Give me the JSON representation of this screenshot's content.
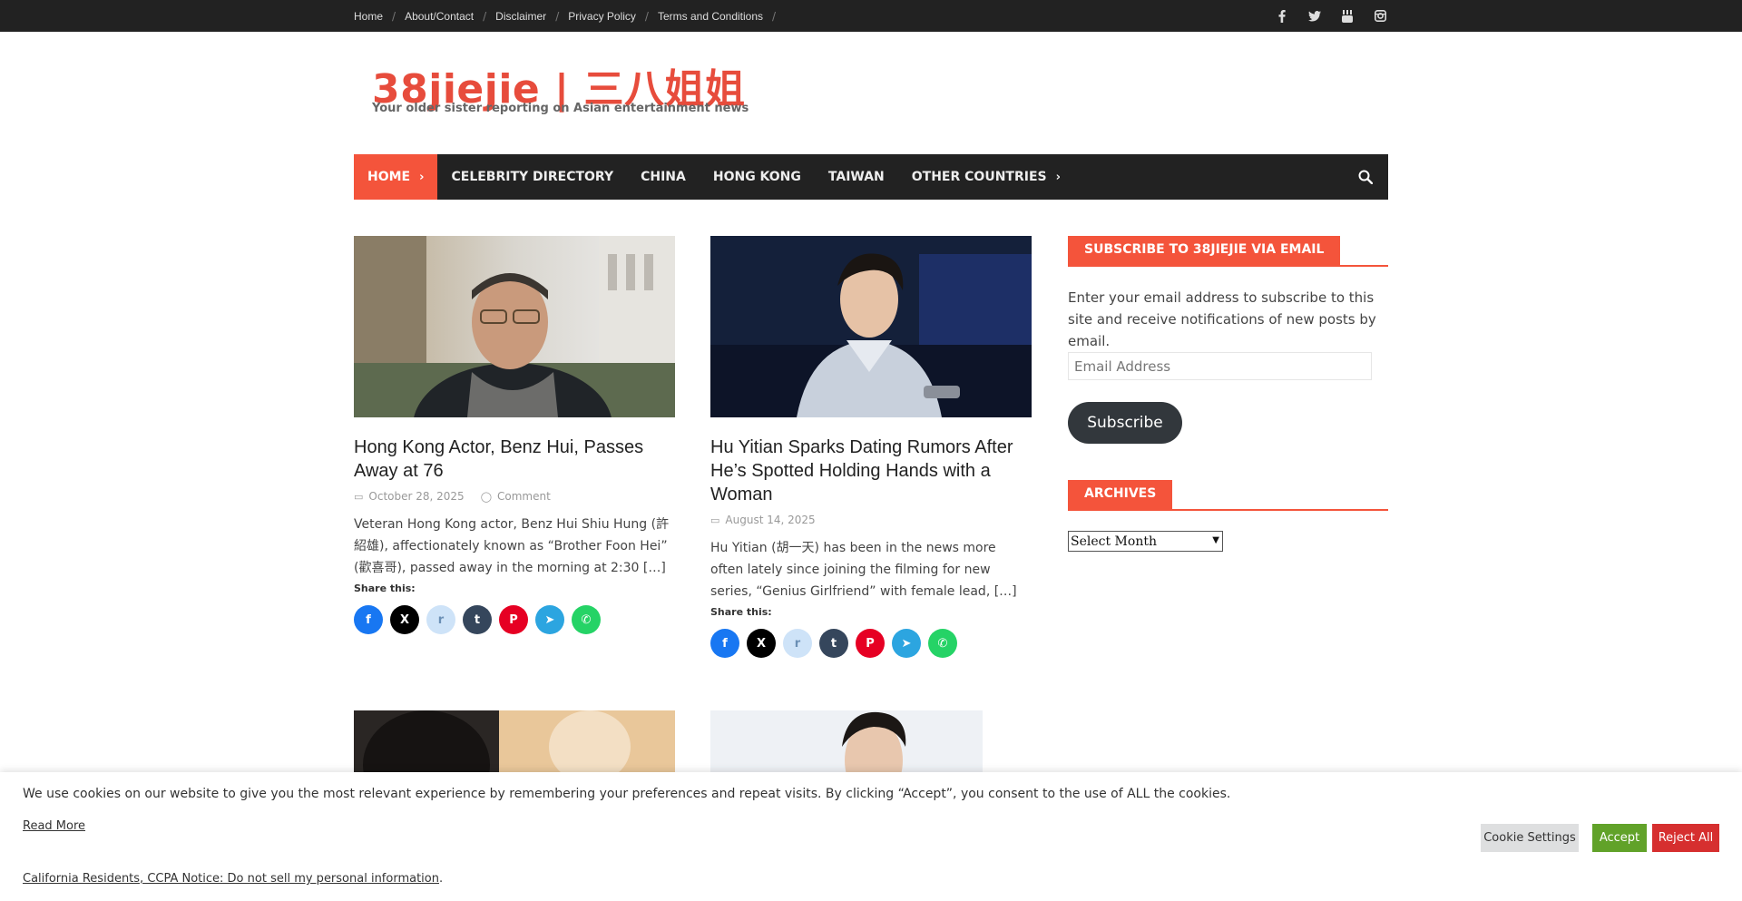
{
  "topbar": {
    "links": [
      "Home",
      "About/Contact",
      "Disclaimer",
      "Privacy Policy",
      "Terms and Conditions"
    ],
    "social": [
      "facebook-icon",
      "twitter-icon",
      "youtube-icon",
      "instagram-icon"
    ]
  },
  "header": {
    "title": "38jiejie | 三八姐姐",
    "tagline": "Your older sister reporting on Asian entertainment news"
  },
  "nav": {
    "items": [
      {
        "label": "Home",
        "active": true,
        "chevron": true
      },
      {
        "label": "Celebrity Directory",
        "active": false,
        "chevron": false
      },
      {
        "label": "China",
        "active": false,
        "chevron": false
      },
      {
        "label": "Hong Kong",
        "active": false,
        "chevron": false
      },
      {
        "label": "Taiwan",
        "active": false,
        "chevron": false
      },
      {
        "label": "Other Countries",
        "active": false,
        "chevron": true
      }
    ]
  },
  "posts": [
    {
      "title": "Hong Kong Actor, Benz Hui, Passes Away at 76",
      "date": "October 28, 2025",
      "comment": "Comment",
      "excerpt": "Veteran Hong Kong actor, Benz Hui Shiu Hung (許紹雄), affectionately known as “Brother Foon Hei” (歡喜哥), passed away in the morning at 2:30 […]",
      "share_label": "Share this:"
    },
    {
      "title": "Hu Yitian Sparks Dating Rumors After He’s Spotted Holding Hands with a Woman",
      "date": "August 14, 2025",
      "comment": "",
      "excerpt": "Hu Yitian (胡一天) has been in the news more often lately since joining the filming for new series, “Genius Girlfriend” with female lead, […]",
      "share_label": "Share this:"
    }
  ],
  "share_buttons": [
    {
      "name": "facebook",
      "color": "#1877f2",
      "glyph": "f"
    },
    {
      "name": "x",
      "color": "#000000",
      "glyph": "X"
    },
    {
      "name": "reddit",
      "color": "#cee3f8",
      "glyph": "r"
    },
    {
      "name": "tumblr",
      "color": "#35465c",
      "glyph": "t"
    },
    {
      "name": "pinterest",
      "color": "#e60023",
      "glyph": "P"
    },
    {
      "name": "telegram",
      "color": "#2ca5e0",
      "glyph": "➤"
    },
    {
      "name": "whatsapp",
      "color": "#25d366",
      "glyph": "✆"
    }
  ],
  "sidebar": {
    "subscribe_title": "SUBSCRIBE TO 38JIEJIE VIA EMAIL",
    "subscribe_text": "Enter your email address to subscribe to this site and receive notifications of new posts by email.",
    "email_placeholder": "Email Address",
    "subscribe_button": "Subscribe",
    "archives_title": "ARCHIVES",
    "archives_select": "Select Month"
  },
  "cookie": {
    "message": "We use cookies on our website to give you the most relevant experience by remembering your preferences and repeat visits. By clicking “Accept”, you consent to the use of ALL the cookies.",
    "read_more": "Read More",
    "ccpa_link": "California Residents, CCPA Notice: Do not sell my personal information",
    "ccpa_end": ".",
    "settings_button": "Cookie Settings",
    "accept_button": "Accept",
    "reject_button": "Reject All"
  },
  "colors": {
    "accent": "#f4543b",
    "dark": "#222222"
  }
}
